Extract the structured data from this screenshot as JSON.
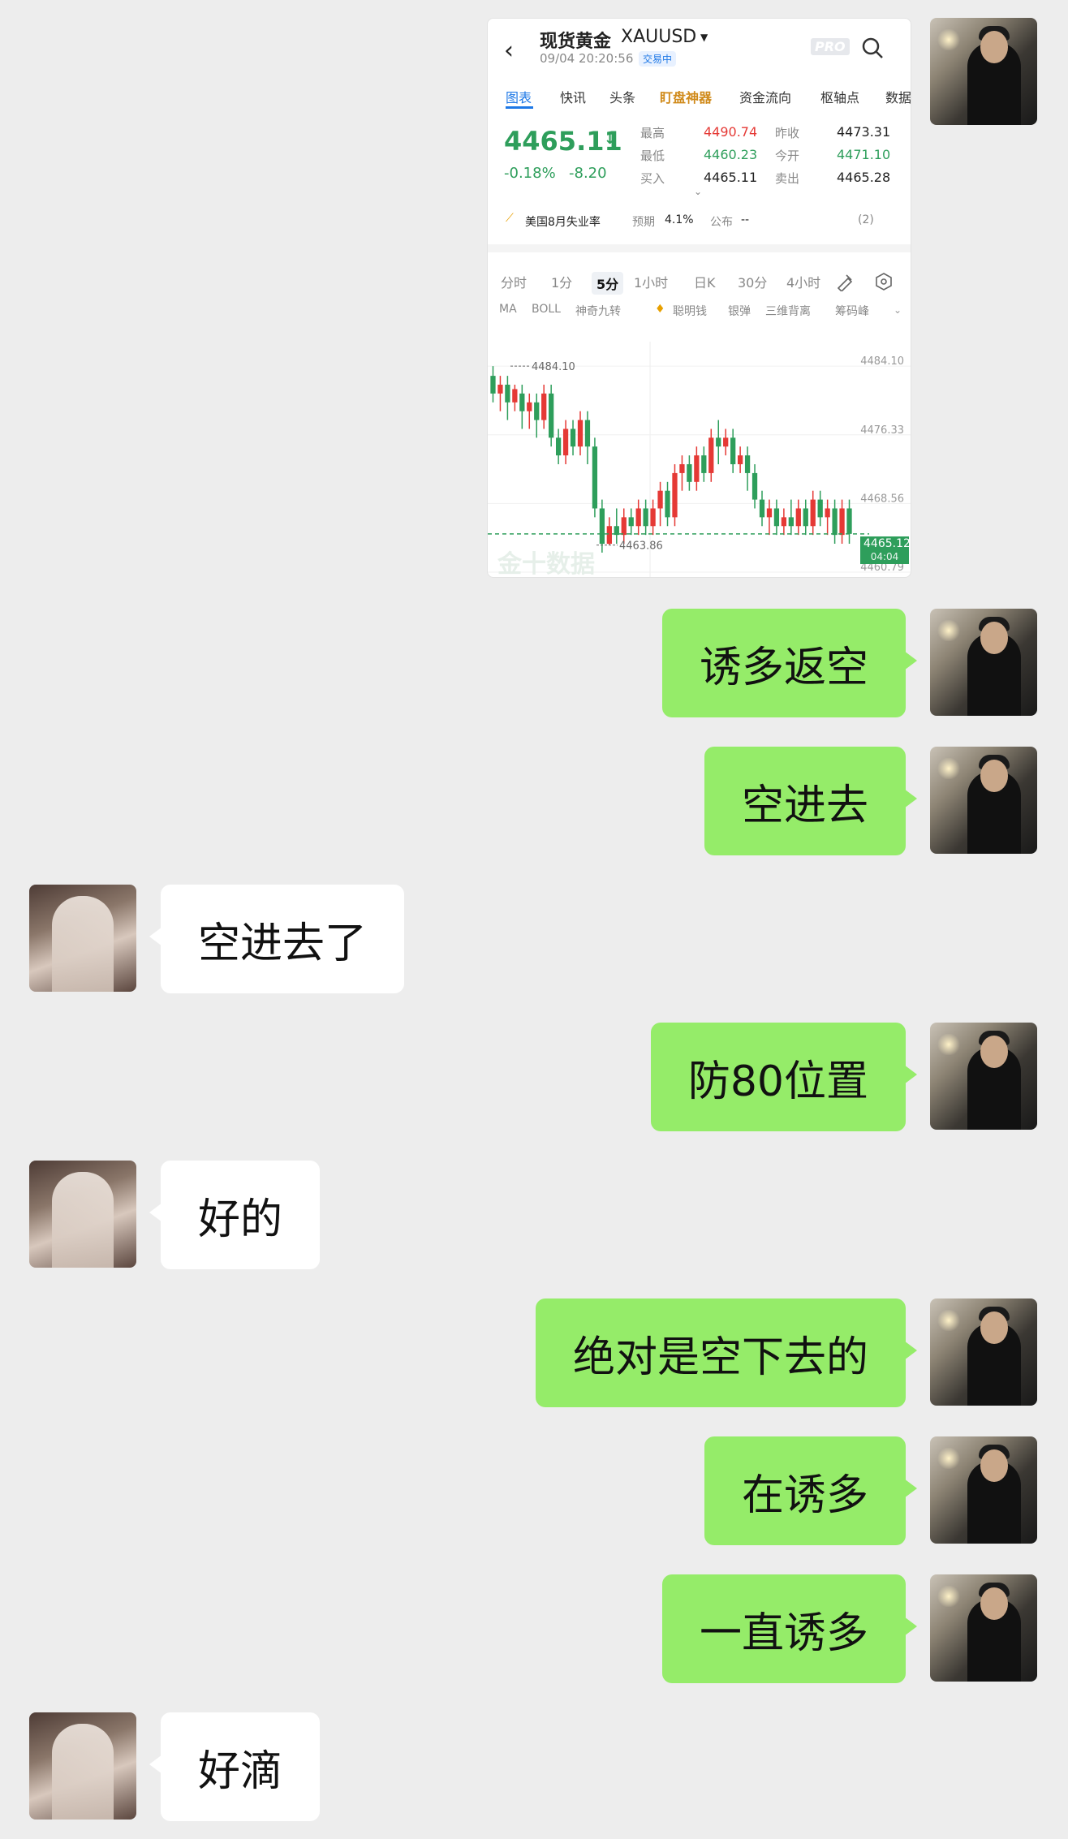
{
  "messages": [
    {
      "side": "right",
      "text": "诱多返空"
    },
    {
      "side": "right",
      "text": "空进去"
    },
    {
      "side": "left",
      "text": "空进去了"
    },
    {
      "side": "right",
      "text": "防80位置"
    },
    {
      "side": "left",
      "text": "好的"
    },
    {
      "side": "right",
      "text": "绝对是空下去的"
    },
    {
      "side": "right",
      "text": "在诱多"
    },
    {
      "side": "right",
      "text": "一直诱多"
    },
    {
      "side": "left",
      "text": "好滴"
    }
  ],
  "card": {
    "title": "现货黄金",
    "symbol": "XAUUSD",
    "datetime": "09/04 20:20:56",
    "status": "交易中",
    "pro": "PRO",
    "tabs": [
      "图表",
      "快讯",
      "头条",
      "盯盘神器",
      "资金流向",
      "枢轴点",
      "数据"
    ],
    "price": "4465.11",
    "change_pct": "-0.18%",
    "change": "-8.20",
    "high_label": "最高",
    "high": "4490.74",
    "low_label": "最低",
    "low": "4460.23",
    "buy_label": "买入",
    "buy": "4465.11",
    "prev_label": "昨收",
    "prev": "4473.31",
    "open_label": "今开",
    "open": "4471.10",
    "sell_label": "卖出",
    "sell": "4465.28",
    "event": "美国8月失业率",
    "forecast_label": "预期",
    "forecast": "4.1%",
    "publish_label": "公布",
    "publish": "--",
    "event_count": "(2)",
    "timeframes": [
      "分时",
      "1分",
      "5分",
      "1小时",
      "日K",
      "30分",
      "4小时"
    ],
    "indicators": [
      "MA",
      "BOLL",
      "神奇九转",
      "聪明钱",
      "银弹",
      "三维背离",
      "筹码峰"
    ],
    "axis_labels": [
      "4484.10",
      "4476.33",
      "4468.56",
      "4460.79"
    ],
    "max_marker": "4484.10",
    "min_marker": "4463.86",
    "last_price": "4465.12",
    "countdown": "04:04",
    "watermark": "金十数据"
  },
  "chart_data": {
    "type": "candlestick",
    "ylim": [
      4460.79,
      4486.5
    ],
    "last": 4465.12,
    "max": 4484.1,
    "min": 4463.86,
    "candles": [
      [
        4483,
        4481,
        4484.1,
        4480
      ],
      [
        4481,
        4482,
        4483,
        4479
      ],
      [
        4482,
        4480,
        4483,
        4478
      ],
      [
        4480,
        4481.5,
        4482,
        4479
      ],
      [
        4481,
        4479,
        4482,
        4477
      ],
      [
        4479,
        4480,
        4481,
        4477
      ],
      [
        4480,
        4478,
        4481,
        4476
      ],
      [
        4478,
        4481,
        4482,
        4477
      ],
      [
        4481,
        4476,
        4482,
        4475
      ],
      [
        4476,
        4474,
        4477,
        4473
      ],
      [
        4474,
        4477,
        4478,
        4473
      ],
      [
        4477,
        4475,
        4478,
        4474
      ],
      [
        4475,
        4478,
        4479,
        4474
      ],
      [
        4478,
        4475,
        4479,
        4473
      ],
      [
        4475,
        4468,
        4476,
        4467
      ],
      [
        4468,
        4464,
        4469,
        4463
      ],
      [
        4464,
        4466,
        4467,
        4463.86
      ],
      [
        4466,
        4465,
        4468,
        4464
      ],
      [
        4465,
        4467,
        4468,
        4464
      ],
      [
        4467,
        4466,
        4468,
        4465
      ],
      [
        4466,
        4468,
        4469,
        4465
      ],
      [
        4468,
        4466,
        4469,
        4465
      ],
      [
        4466,
        4468,
        4469,
        4465
      ],
      [
        4468,
        4470,
        4471,
        4466
      ],
      [
        4470,
        4467,
        4471,
        4466
      ],
      [
        4467,
        4472,
        4473,
        4466
      ],
      [
        4472,
        4473,
        4474,
        4470
      ],
      [
        4473,
        4471,
        4474,
        4470
      ],
      [
        4471,
        4474,
        4475,
        4470
      ],
      [
        4474,
        4472,
        4475,
        4471
      ],
      [
        4472,
        4476,
        4477,
        4471
      ],
      [
        4476,
        4475,
        4478,
        4473
      ],
      [
        4475,
        4476,
        4477,
        4474
      ],
      [
        4476,
        4473,
        4477,
        4472
      ],
      [
        4473,
        4474,
        4475,
        4472
      ],
      [
        4474,
        4472,
        4475,
        4470
      ],
      [
        4472,
        4469,
        4473,
        4468
      ],
      [
        4469,
        4467,
        4470,
        4466
      ],
      [
        4467,
        4468,
        4469,
        4465
      ],
      [
        4468,
        4466,
        4469,
        4465
      ],
      [
        4466,
        4467,
        4468,
        4465
      ],
      [
        4467,
        4466,
        4469,
        4465
      ],
      [
        4466,
        4468,
        4469,
        4465
      ],
      [
        4468,
        4466,
        4469,
        4465
      ],
      [
        4466,
        4469,
        4470,
        4465
      ],
      [
        4469,
        4467,
        4470,
        4466
      ],
      [
        4467,
        4468,
        4469,
        4465
      ],
      [
        4468,
        4465,
        4469,
        4464
      ],
      [
        4465,
        4468,
        4469,
        4464
      ],
      [
        4468,
        4465.12,
        4469,
        4464
      ]
    ]
  }
}
